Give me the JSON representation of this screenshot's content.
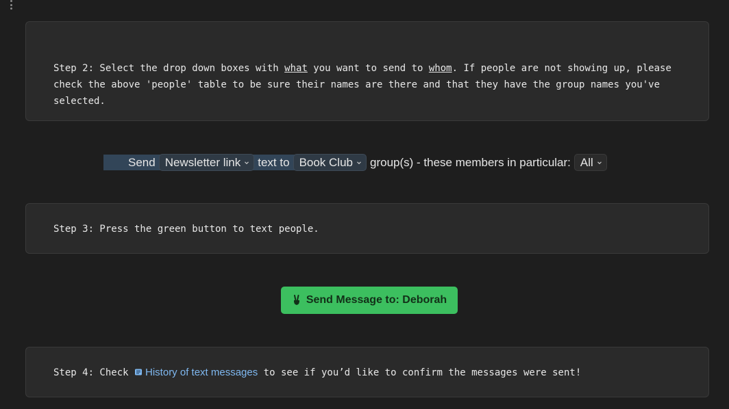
{
  "step2": {
    "prefix": "Step 2: Select the drop down boxes with ",
    "what": "what",
    "mid": " you want to send to ",
    "whom": "whom",
    "suffix": ". If people are not showing up, please check the above 'people' table to be sure their names are there and that they have the group names you've selected."
  },
  "sentence": {
    "send": "Send",
    "message_type": "Newsletter link",
    "text_to": "text to",
    "group": "Book Club",
    "groups_text": "group(s) - these members in particular:",
    "members": "All"
  },
  "step3": {
    "text": "Step 3: Press the green button to text people."
  },
  "send_button": {
    "label": "Send Message to: Deborah",
    "color": "#3cbf5f"
  },
  "step4": {
    "prefix": "Step 4: Check ",
    "link": "History of text messages",
    "suffix": " to see if you’d like to confirm the messages were sent!",
    "link_color": "#7fb8f0"
  },
  "icons": {
    "menu": "vertical-ellipsis-icon",
    "dropdown": "chevron-down-icon",
    "button": "victory-hand-icon",
    "link": "scroll-icon"
  }
}
